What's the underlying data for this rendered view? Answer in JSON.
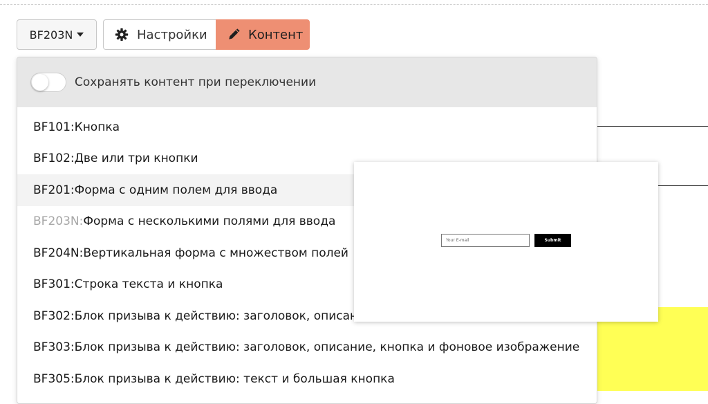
{
  "toolbar": {
    "block_selector_label": "BF203N",
    "settings_label": "Настройки",
    "content_label": "Контент"
  },
  "dropdown": {
    "toggle_label": "Сохранять контент при переключении",
    "toggle_on": false,
    "items": [
      {
        "code": "BF101",
        "sep": ": ",
        "text": "Кнопка"
      },
      {
        "code": "BF102",
        "sep": ": ",
        "text": "Две или три кнопки"
      },
      {
        "code": "BF201",
        "sep": ": ",
        "text": "Форма с одним полем для ввода"
      },
      {
        "code": "BF203N",
        "sep": ": ",
        "text": "Форма с несколькими полями для ввода"
      },
      {
        "code": "BF204N",
        "sep": ": ",
        "text": "Вертикальная форма с множеством полей"
      },
      {
        "code": "BF301",
        "sep": ": ",
        "text": "Строка текста и кнопка"
      },
      {
        "code": "BF302",
        "sep": ": ",
        "text": "Блок призыва к действию: заголовок, описан"
      },
      {
        "code": "BF303",
        "sep": ": ",
        "text": "Блок призыва к действию: заголовок, описание, кнопка и фоновое изображение"
      },
      {
        "code": "BF305",
        "sep": ": ",
        "text": "Блок призыва к действию: текст и большая кнопка"
      }
    ]
  },
  "preview": {
    "input_placeholder": "Your E-mail",
    "button_label": "Submit"
  },
  "colors": {
    "accent": "#ee8f73",
    "yellow": "#ffff55"
  }
}
